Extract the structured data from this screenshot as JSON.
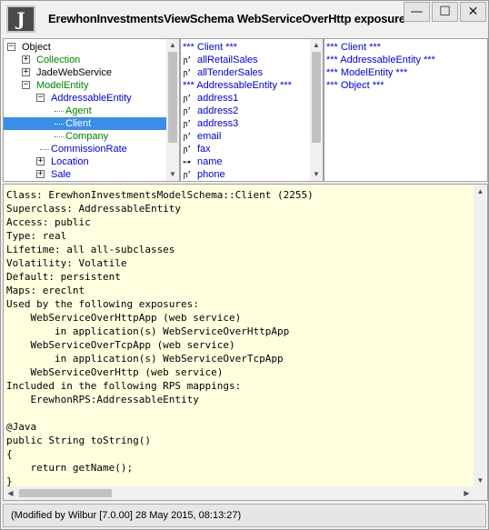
{
  "window": {
    "title": "ErewhonInvestmentsViewSchema WebServiceOverHttp exposure",
    "app_icon_letter": "J",
    "controls": {
      "minimize": "—",
      "maximize": "☐",
      "close": "✕"
    }
  },
  "class_tree": {
    "items": [
      {
        "label": "Object",
        "expander": "−",
        "color": "black",
        "selected": false
      },
      {
        "label": "Collection",
        "expander": "+",
        "color": "green",
        "selected": false
      },
      {
        "label": "JadeWebService",
        "expander": "+",
        "color": "black",
        "selected": false
      },
      {
        "label": "ModelEntity",
        "expander": "−",
        "color": "green",
        "selected": false
      },
      {
        "label": "AddressableEntity",
        "expander": "−",
        "color": "blue",
        "selected": false
      },
      {
        "label": "Agent",
        "expander": "",
        "color": "green",
        "selected": false
      },
      {
        "label": "Client",
        "expander": "",
        "color": "blue",
        "selected": true
      },
      {
        "label": "Company",
        "expander": "",
        "color": "green",
        "selected": false
      },
      {
        "label": "CommissionRate",
        "expander": "",
        "color": "blue",
        "selected": false
      },
      {
        "label": "Location",
        "expander": "+",
        "color": "blue",
        "selected": false
      },
      {
        "label": "Sale",
        "expander": "+",
        "color": "blue",
        "selected": false
      }
    ]
  },
  "properties": {
    "items": [
      {
        "label": "*** Client ***",
        "icon": ""
      },
      {
        "label": "allRetailSales",
        "icon": "ref-icon"
      },
      {
        "label": "allTenderSales",
        "icon": "ref-icon"
      },
      {
        "label": "*** AddressableEntity ***",
        "icon": ""
      },
      {
        "label": "address1",
        "icon": "ref-icon"
      },
      {
        "label": "address2",
        "icon": "ref-icon"
      },
      {
        "label": "address3",
        "icon": "ref-icon"
      },
      {
        "label": "email",
        "icon": "ref-icon"
      },
      {
        "label": "fax",
        "icon": "ref-icon"
      },
      {
        "label": "name",
        "icon": "key-icon"
      },
      {
        "label": "phone",
        "icon": "ref-icon"
      }
    ]
  },
  "superclasses": {
    "items": [
      {
        "label": "*** Client ***",
        "color": "blue"
      },
      {
        "label": "*** AddressableEntity ***",
        "color": "blue"
      },
      {
        "label": "*** ModelEntity ***",
        "color": "blue"
      },
      {
        "label": "*** Object ***",
        "color": "red"
      }
    ]
  },
  "details": {
    "lines": [
      "Class: ErewhonInvestmentsModelSchema::Client (2255)",
      "Superclass: AddressableEntity",
      "Access: public",
      "Type: real",
      "Lifetime: all all-subclasses",
      "Volatility: Volatile",
      "Default: persistent",
      "Maps: ereclnt",
      "Used by the following exposures:",
      "    WebServiceOverHttpApp (web service)",
      "        in application(s) WebServiceOverHttpApp",
      "    WebServiceOverTcpApp (web service)",
      "        in application(s) WebServiceOverTcpApp",
      "    WebServiceOverHttp (web service)",
      "Included in the following RPS mappings:",
      "    ErewhonRPS:AddressableEntity",
      "",
      "@Java",
      "public String toString()",
      "{",
      "    return getName();",
      "}"
    ]
  },
  "status": {
    "text": "(Modified by Wilbur [7.0.00] 28 May 2015, 08:13:27)"
  },
  "colors": {
    "selection": "#3a8ee6",
    "text_area_bg": "#ffffe0",
    "green_text": "#008000",
    "blue_text": "#0000d0",
    "red_text": "#d00000"
  }
}
